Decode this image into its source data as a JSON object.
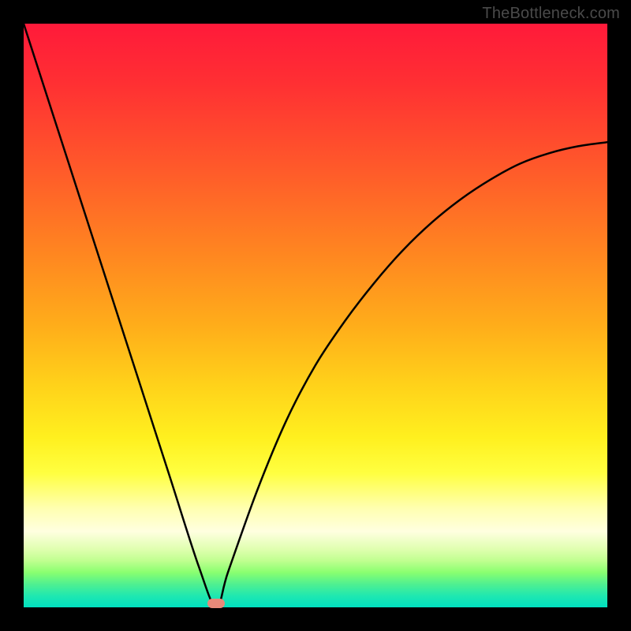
{
  "watermark": "TheBottleneck.com",
  "chart_data": {
    "type": "line",
    "title": "",
    "xlabel": "",
    "ylabel": "",
    "xlim": [
      0,
      1
    ],
    "ylim": [
      0,
      1
    ],
    "grid": false,
    "legend": false,
    "series": [
      {
        "name": "bottleneck-curve",
        "x": [
          0.0,
          0.05,
          0.1,
          0.15,
          0.2,
          0.25,
          0.3,
          0.33,
          0.35,
          0.4,
          0.45,
          0.5,
          0.55,
          0.6,
          0.65,
          0.7,
          0.75,
          0.8,
          0.85,
          0.9,
          0.95,
          1.0
        ],
        "y": [
          1.0,
          0.845,
          0.69,
          0.535,
          0.38,
          0.225,
          0.07,
          0.0,
          0.06,
          0.2,
          0.32,
          0.415,
          0.49,
          0.555,
          0.612,
          0.66,
          0.7,
          0.733,
          0.76,
          0.778,
          0.79,
          0.797
        ]
      }
    ],
    "annotations": [
      {
        "name": "minimum-marker",
        "x": 0.33,
        "y": 0.007,
        "color": "#e88a7a"
      }
    ],
    "background": "gradient-red-to-green-vertical"
  },
  "colors": {
    "curve": "#000000",
    "frame_bg": "#000000",
    "marker": "#e88a7a"
  }
}
